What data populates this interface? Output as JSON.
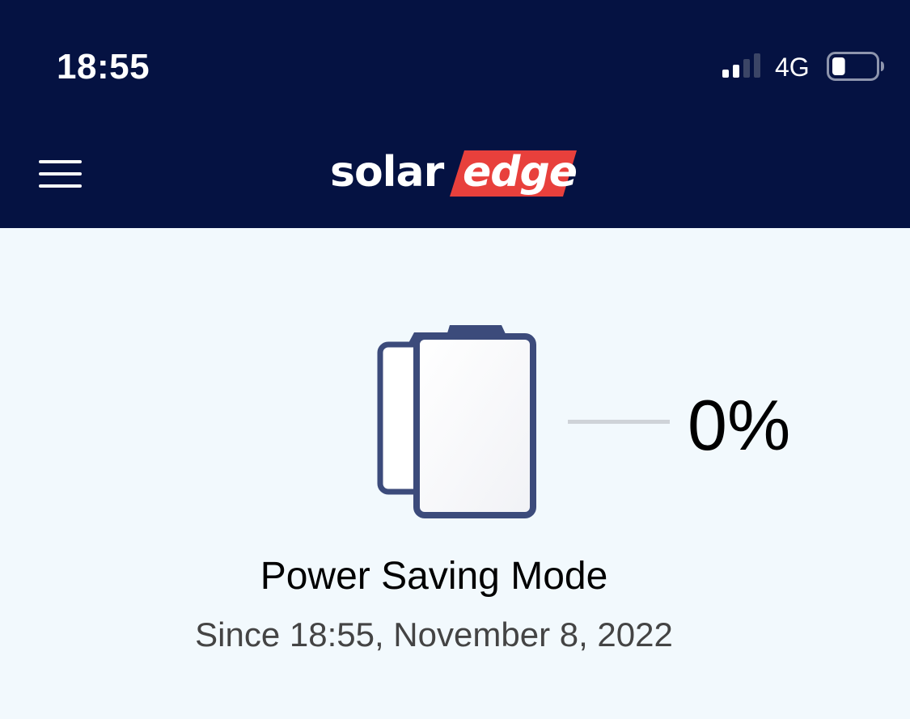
{
  "status_bar": {
    "time": "18:55",
    "network": "4G",
    "signal_bars_active": 2,
    "signal_bars_total": 4,
    "battery_level_fraction": 0.3
  },
  "header": {
    "menu_icon": "hamburger-menu-icon",
    "logo_part1": "solar",
    "logo_part2": "edge"
  },
  "battery": {
    "icon": "battery-storage-icon",
    "percent": "0%"
  },
  "mode": {
    "title": "Power Saving Mode",
    "since": "Since 18:55, November 8, 2022"
  },
  "colors": {
    "header_bg": "#051242",
    "page_bg": "#f2f9fd",
    "brand_red": "#e8403c",
    "battery_outline": "#3c4b7b"
  }
}
